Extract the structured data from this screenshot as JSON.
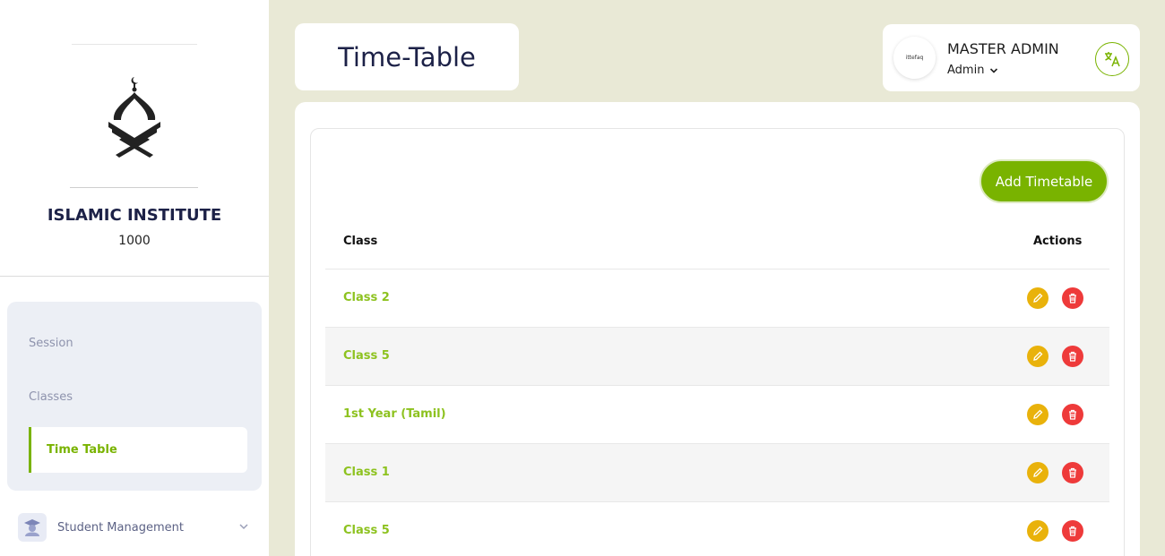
{
  "institute": {
    "name": "ISLAMIC INSTITUTE",
    "code": "1000"
  },
  "sidebar": {
    "submenu": [
      {
        "label": "Session",
        "active": false
      },
      {
        "label": "Classes",
        "active": false
      },
      {
        "label": "Time Table",
        "active": true
      }
    ],
    "menu": [
      {
        "label": "Student Management",
        "icon": "student-icon"
      }
    ]
  },
  "header": {
    "title": "Time-Table",
    "user": {
      "name": "MASTER ADMIN",
      "role": "Admin",
      "avatar_text": "ittefaq"
    }
  },
  "main": {
    "add_button": "Add Timetable",
    "columns": {
      "class": "Class",
      "actions": "Actions"
    },
    "rows": [
      {
        "class": "Class 2"
      },
      {
        "class": "Class 5"
      },
      {
        "class": "1st Year (Tamil)"
      },
      {
        "class": "Class 1"
      },
      {
        "class": "Class 5"
      }
    ]
  },
  "colors": {
    "accent": "#79b300",
    "edit": "#e9b20b",
    "delete": "#ee3a3a",
    "background": "#e9e9d6"
  }
}
